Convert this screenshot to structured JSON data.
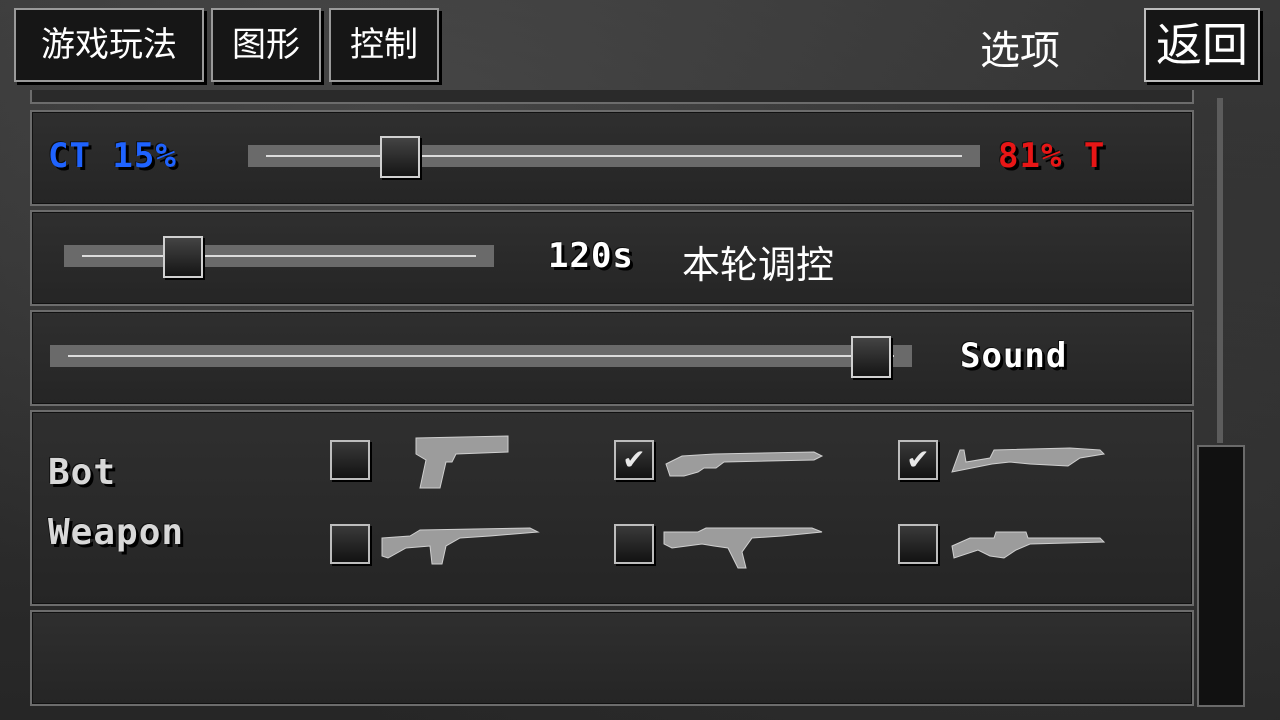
{
  "tabs": [
    "游戏玩法",
    "图形",
    "控制"
  ],
  "title": "选项",
  "back_label": "返回",
  "team_balance": {
    "ct_label": "CT 15%",
    "t_label": "81% T",
    "value_fraction": 0.19,
    "ct_color": "#1f63ff",
    "t_color": "#e81616"
  },
  "round_time": {
    "value_label": "120s",
    "label": "本轮调控",
    "value_fraction": 0.25
  },
  "sound": {
    "label": "Sound",
    "value_fraction": 0.97
  },
  "bot_weapon": {
    "label_line1": "Bot",
    "label_line2": "Weapon",
    "weapons": [
      {
        "icon": "pistol-icon",
        "checked": false
      },
      {
        "icon": "shotgun-icon",
        "checked": true
      },
      {
        "icon": "smg-icon",
        "checked": true
      },
      {
        "icon": "rifle-icon",
        "checked": false
      },
      {
        "icon": "assault-rifle-icon",
        "checked": false
      },
      {
        "icon": "sniper-rifle-icon",
        "checked": false
      }
    ]
  }
}
